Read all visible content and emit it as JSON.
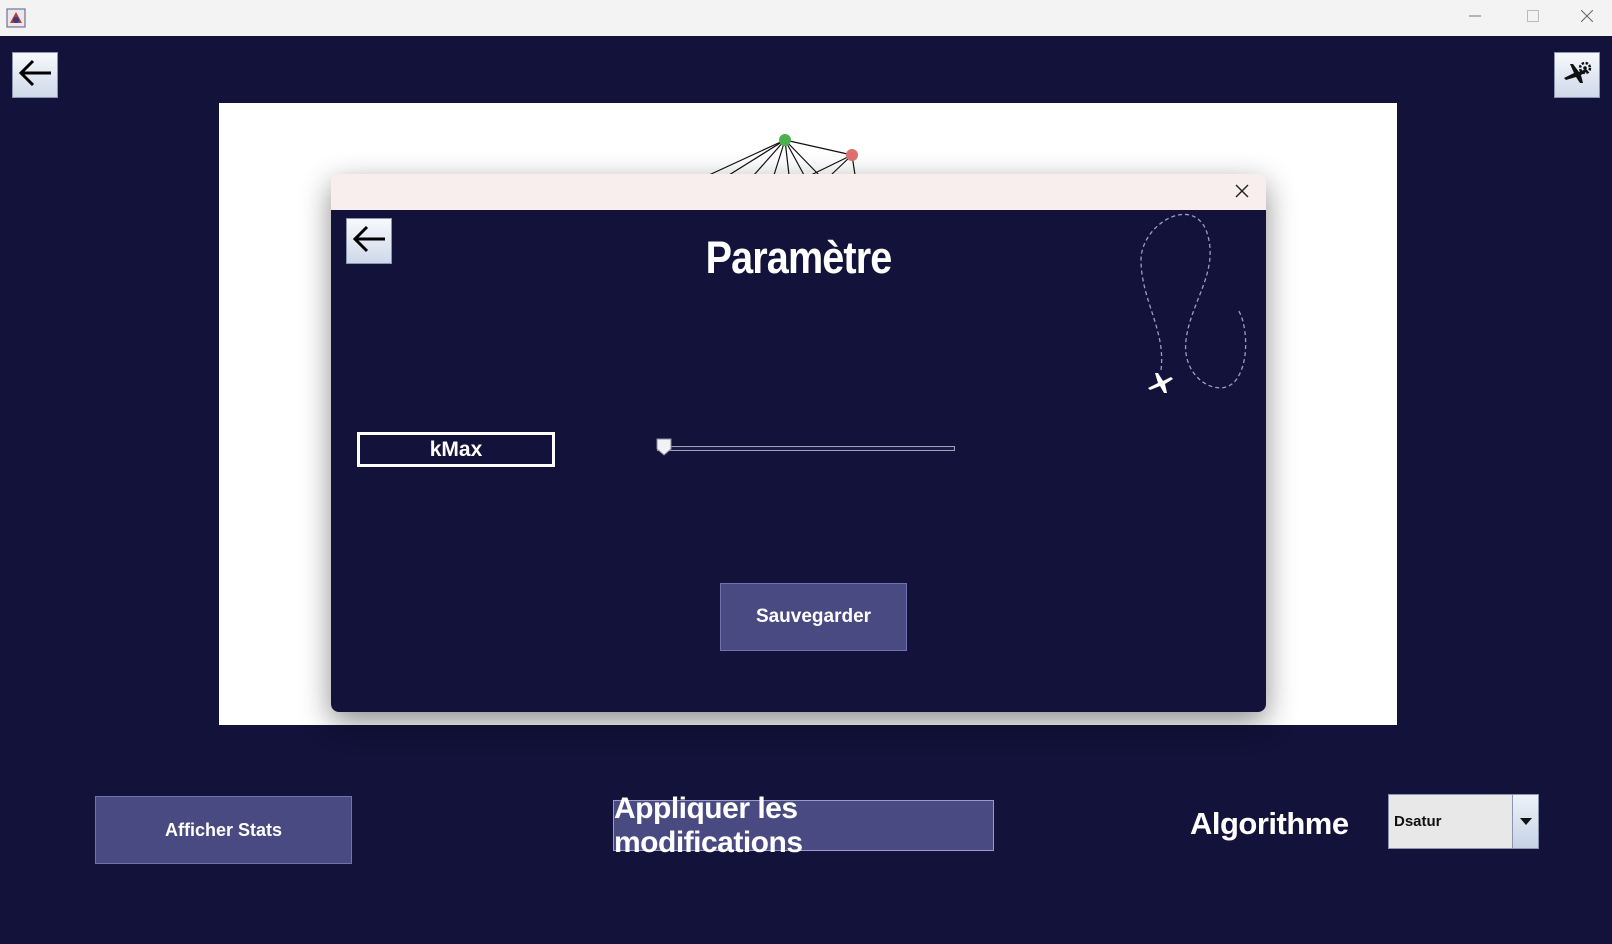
{
  "window": {
    "minimize_icon": "minimize-icon",
    "maximize_icon": "maximize-icon",
    "close_icon": "close-icon"
  },
  "toolbar": {
    "back_icon": "arrow-left-icon",
    "settings_icon": "airplane-gear-icon"
  },
  "dialog": {
    "title": "Paramètre",
    "back_icon": "arrow-left-icon",
    "close_icon": "close-icon",
    "decoration_icon": "airplane-icon",
    "kmax_label": "kMax",
    "kmax_slider_level": 0,
    "save_label": "Sauvegarder"
  },
  "bottom": {
    "stats_label": "Afficher Stats",
    "apply_label": "Appliquer les modifications",
    "algorithm_label": "Algorithme",
    "algorithm_selected": "Dsatur"
  },
  "colors": {
    "background": "#12123a",
    "button": "#4a4a82",
    "node_green": "#4caf50",
    "node_red": "#e07070"
  }
}
